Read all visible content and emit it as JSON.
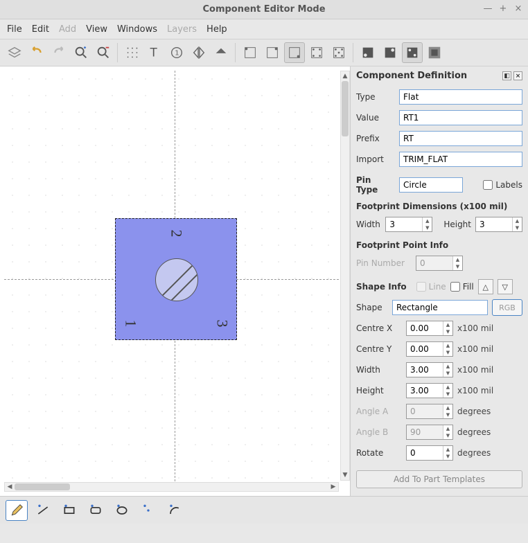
{
  "window": {
    "title": "Component Editor Mode"
  },
  "menu": {
    "file": "File",
    "edit": "Edit",
    "add": "Add",
    "view": "View",
    "windows": "Windows",
    "layers": "Layers",
    "help": "Help"
  },
  "panel": {
    "title": "Component Definition",
    "type_label": "Type",
    "type_value": "Flat",
    "value_label": "Value",
    "value_value": "RT1",
    "prefix_label": "Prefix",
    "prefix_value": "RT",
    "import_label": "Import",
    "import_value": "TRIM_FLAT",
    "pin_type_label": "Pin Type",
    "pin_type_value": "Circle",
    "labels_chk": "Labels",
    "footprint_dims": "Footprint Dimensions (x100 mil)",
    "width_label": "Width",
    "width_value": "3",
    "height_label": "Height",
    "height_value": "3",
    "footprint_point": "Footprint Point Info",
    "pin_number_label": "Pin Number",
    "pin_number_value": "0",
    "shape_info": "Shape Info",
    "line_label": "Line",
    "fill_label": "Fill",
    "shape_label": "Shape",
    "shape_value": "Rectangle",
    "rgb": "RGB",
    "centre_x_label": "Centre X",
    "centre_x_value": "0.00",
    "centre_y_label": "Centre Y",
    "centre_y_value": "0.00",
    "w2_label": "Width",
    "w2_value": "3.00",
    "h2_label": "Height",
    "h2_value": "3.00",
    "angle_a_label": "Angle A",
    "angle_a_value": "0",
    "angle_b_label": "Angle B",
    "angle_b_value": "90",
    "rotate_label": "Rotate",
    "rotate_value": "0",
    "unit_mil": "x100 mil",
    "unit_deg": "degrees",
    "add_btn": "Add To Part Templates"
  },
  "canvas": {
    "pin1": "1",
    "pin2": "2",
    "pin3": "3"
  }
}
